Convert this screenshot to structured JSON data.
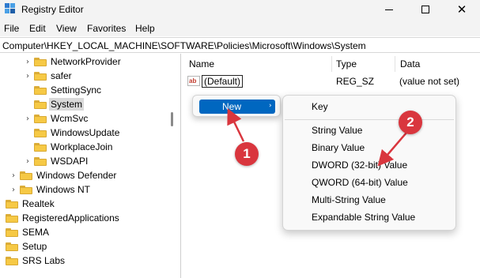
{
  "window": {
    "title": "Registry Editor",
    "minimize_glyph": "",
    "maximize_glyph": "",
    "close_glyph": "✕"
  },
  "menubar": {
    "file": "File",
    "edit": "Edit",
    "view": "View",
    "favorites": "Favorites",
    "help": "Help"
  },
  "address": {
    "path": "Computer\\HKEY_LOCAL_MACHINE\\SOFTWARE\\Policies\\Microsoft\\Windows\\System"
  },
  "tree": {
    "items": [
      {
        "label": "NetworkProvider",
        "expander": "›",
        "selected": false
      },
      {
        "label": "safer",
        "expander": "›",
        "selected": false
      },
      {
        "label": "SettingSync",
        "expander": "",
        "selected": false
      },
      {
        "label": "System",
        "expander": "",
        "selected": true
      },
      {
        "label": "WcmSvc",
        "expander": "›",
        "selected": false
      },
      {
        "label": "WindowsUpdate",
        "expander": "",
        "selected": false
      },
      {
        "label": "WorkplaceJoin",
        "expander": "",
        "selected": false
      },
      {
        "label": "WSDAPI",
        "expander": "›",
        "selected": false
      },
      {
        "label": "Windows Defender",
        "expander": "›",
        "selected": false
      },
      {
        "label": "Windows NT",
        "expander": "›",
        "selected": false
      },
      {
        "label": "Realtek",
        "expander": "",
        "selected": false
      },
      {
        "label": "RegisteredApplications",
        "expander": "",
        "selected": false
      },
      {
        "label": "SEMA",
        "expander": "",
        "selected": false
      },
      {
        "label": "Setup",
        "expander": "",
        "selected": false
      },
      {
        "label": "SRS Labs",
        "expander": "",
        "selected": false
      }
    ]
  },
  "list": {
    "columns": {
      "name": "Name",
      "type": "Type",
      "data": "Data"
    },
    "rows": [
      {
        "icon": "string-value-icon",
        "icon_text": "ab",
        "name": "(Default)",
        "type": "REG_SZ",
        "data": "(value not set)"
      }
    ]
  },
  "context_menu": {
    "new_label": "New",
    "new_arrow": "›",
    "highlight_color": "#0067c0"
  },
  "submenu": {
    "items": [
      "Key",
      "String Value",
      "Binary Value",
      "DWORD (32-bit) Value",
      "QWORD (64-bit) Value",
      "Multi-String Value",
      "Expandable String Value"
    ]
  },
  "annotations": {
    "step1": "1",
    "step2": "2",
    "color": "#d9363e"
  }
}
